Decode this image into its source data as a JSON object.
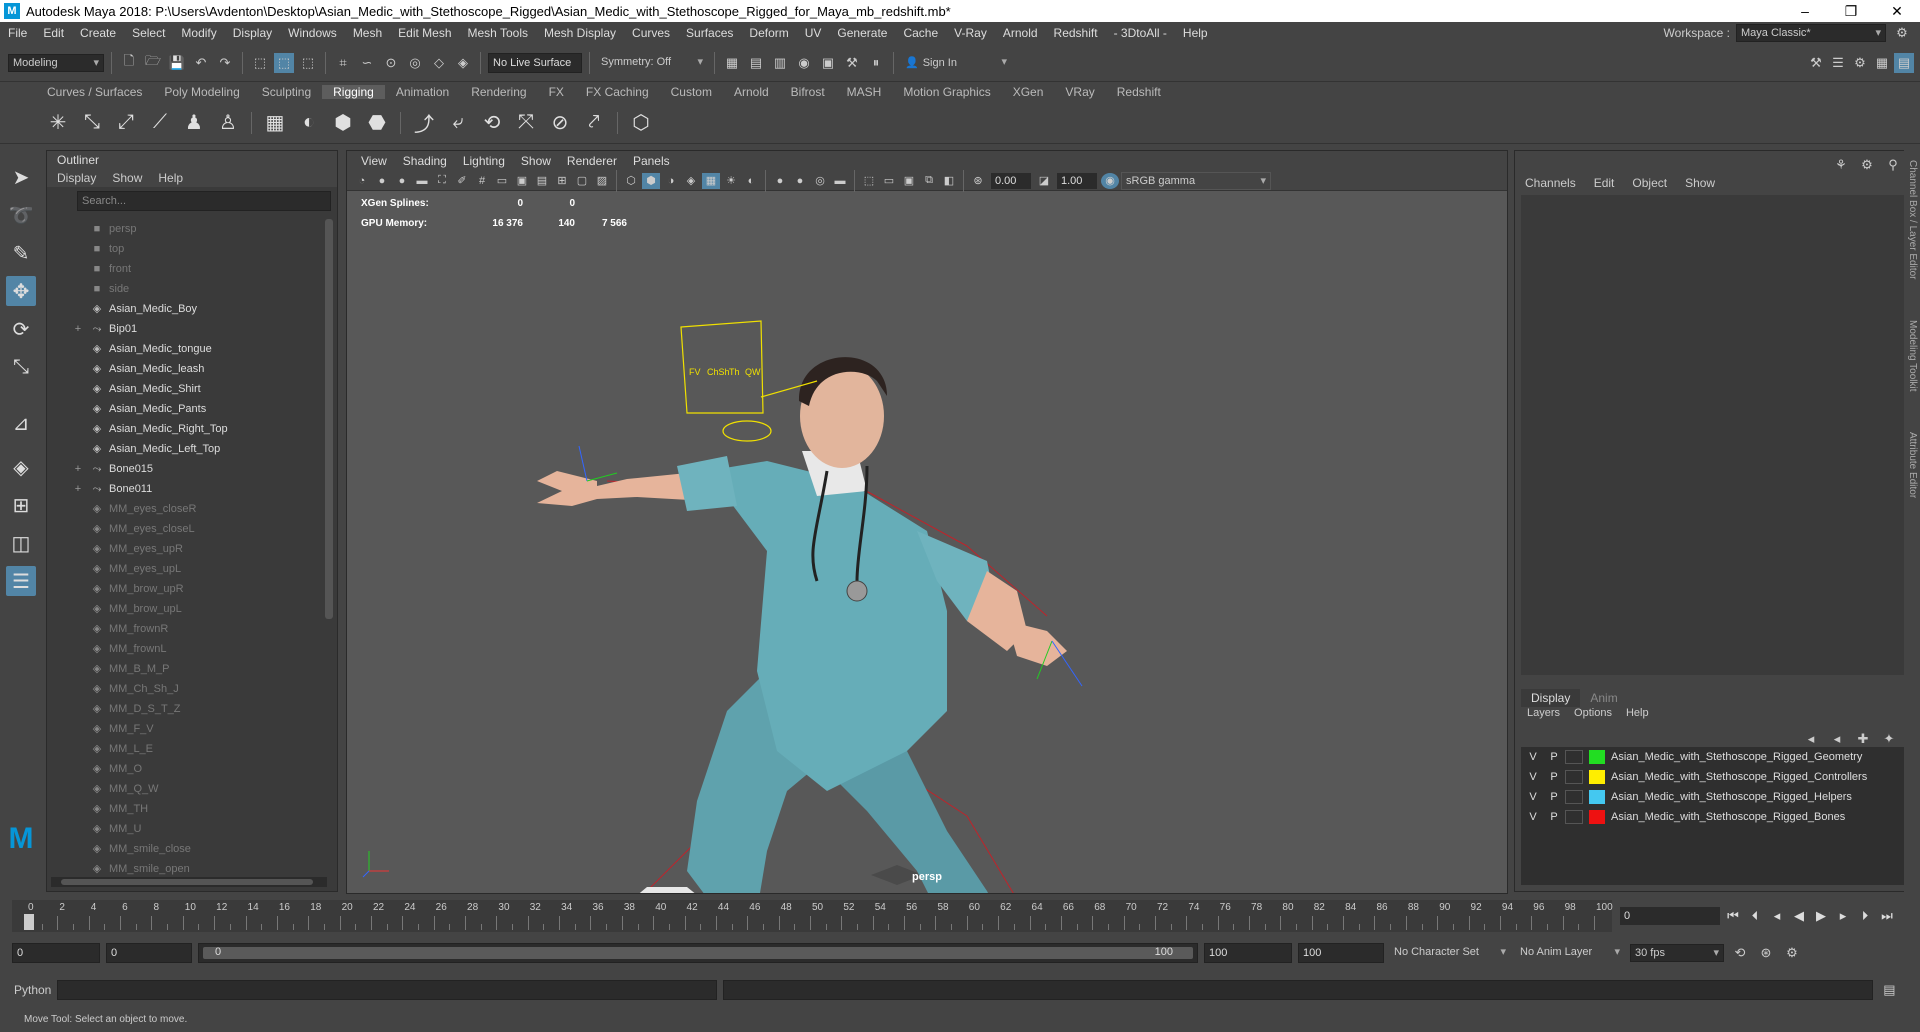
{
  "window": {
    "title": "Autodesk Maya 2018: P:\\Users\\Avdenton\\Desktop\\Asian_Medic_with_Stethoscope_Rigged\\Asian_Medic_with_Stethoscope_Rigged_for_Maya_mb_redshift.mb*",
    "logo": "M"
  },
  "menubar": {
    "items": [
      "File",
      "Edit",
      "Create",
      "Select",
      "Modify",
      "Display",
      "Windows",
      "Mesh",
      "Edit Mesh",
      "Mesh Tools",
      "Mesh Display",
      "Curves",
      "Surfaces",
      "Deform",
      "UV",
      "Generate",
      "Cache",
      "V-Ray",
      "Arnold",
      "Redshift",
      "- 3DtoAll -",
      "Help"
    ],
    "workspace_label": "Workspace :",
    "workspace_value": "Maya Classic*"
  },
  "statusline": {
    "mode": "Modeling",
    "live_surface": "No Live Surface",
    "symmetry": "Symmetry: Off",
    "sign_in": "Sign In"
  },
  "shelf": {
    "tabs": [
      "Curves / Surfaces",
      "Poly Modeling",
      "Sculpting",
      "Rigging",
      "Animation",
      "Rendering",
      "FX",
      "FX Caching",
      "Custom",
      "Arnold",
      "Bifrost",
      "MASH",
      "Motion Graphics",
      "XGen",
      "VRay",
      "Redshift"
    ],
    "active_tab": "Rigging"
  },
  "outliner": {
    "title": "Outliner",
    "menu": [
      "Display",
      "Show",
      "Help"
    ],
    "search_placeholder": "Search...",
    "items": [
      {
        "label": "persp",
        "dim": true,
        "expand": "",
        "icon": "camera-icon"
      },
      {
        "label": "top",
        "dim": true,
        "expand": "",
        "icon": "camera-icon"
      },
      {
        "label": "front",
        "dim": true,
        "expand": "",
        "icon": "camera-icon"
      },
      {
        "label": "side",
        "dim": true,
        "expand": "",
        "icon": "camera-icon"
      },
      {
        "label": "Asian_Medic_Boy",
        "dim": false,
        "expand": "",
        "icon": "mesh-icon"
      },
      {
        "label": "Bip01",
        "dim": false,
        "expand": "+",
        "icon": "joint-icon"
      },
      {
        "label": "Asian_Medic_tongue",
        "dim": false,
        "expand": "",
        "icon": "mesh-icon"
      },
      {
        "label": "Asian_Medic_leash",
        "dim": false,
        "expand": "",
        "icon": "mesh-icon"
      },
      {
        "label": "Asian_Medic_Shirt",
        "dim": false,
        "expand": "",
        "icon": "mesh-icon"
      },
      {
        "label": "Asian_Medic_Pants",
        "dim": false,
        "expand": "",
        "icon": "mesh-icon"
      },
      {
        "label": "Asian_Medic_Right_Top",
        "dim": false,
        "expand": "",
        "icon": "mesh-icon"
      },
      {
        "label": "Asian_Medic_Left_Top",
        "dim": false,
        "expand": "",
        "icon": "mesh-icon"
      },
      {
        "label": "Bone015",
        "dim": false,
        "expand": "+",
        "icon": "joint-icon"
      },
      {
        "label": "Bone011",
        "dim": false,
        "expand": "+",
        "icon": "joint-icon"
      },
      {
        "label": "MM_eyes_closeR",
        "dim": true,
        "expand": "",
        "icon": "mesh-icon"
      },
      {
        "label": "MM_eyes_closeL",
        "dim": true,
        "expand": "",
        "icon": "mesh-icon"
      },
      {
        "label": "MM_eyes_upR",
        "dim": true,
        "expand": "",
        "icon": "mesh-icon"
      },
      {
        "label": "MM_eyes_upL",
        "dim": true,
        "expand": "",
        "icon": "mesh-icon"
      },
      {
        "label": "MM_brow_upR",
        "dim": true,
        "expand": "",
        "icon": "mesh-icon"
      },
      {
        "label": "MM_brow_upL",
        "dim": true,
        "expand": "",
        "icon": "mesh-icon"
      },
      {
        "label": "MM_frownR",
        "dim": true,
        "expand": "",
        "icon": "mesh-icon"
      },
      {
        "label": "MM_frownL",
        "dim": true,
        "expand": "",
        "icon": "mesh-icon"
      },
      {
        "label": "MM_B_M_P",
        "dim": true,
        "expand": "",
        "icon": "mesh-icon"
      },
      {
        "label": "MM_Ch_Sh_J",
        "dim": true,
        "expand": "",
        "icon": "mesh-icon"
      },
      {
        "label": "MM_D_S_T_Z",
        "dim": true,
        "expand": "",
        "icon": "mesh-icon"
      },
      {
        "label": "MM_F_V",
        "dim": true,
        "expand": "",
        "icon": "mesh-icon"
      },
      {
        "label": "MM_L_E",
        "dim": true,
        "expand": "",
        "icon": "mesh-icon"
      },
      {
        "label": "MM_O",
        "dim": true,
        "expand": "",
        "icon": "mesh-icon"
      },
      {
        "label": "MM_Q_W",
        "dim": true,
        "expand": "",
        "icon": "mesh-icon"
      },
      {
        "label": "MM_TH",
        "dim": true,
        "expand": "",
        "icon": "mesh-icon"
      },
      {
        "label": "MM_U",
        "dim": true,
        "expand": "",
        "icon": "mesh-icon"
      },
      {
        "label": "MM_smile_close",
        "dim": true,
        "expand": "",
        "icon": "mesh-icon"
      },
      {
        "label": "MM_smile_open",
        "dim": true,
        "expand": "",
        "icon": "mesh-icon"
      }
    ]
  },
  "viewport": {
    "menu": [
      "View",
      "Shading",
      "Lighting",
      "Show",
      "Renderer",
      "Panels"
    ],
    "near_value": "0.00",
    "far_value": "1.00",
    "color_space": "sRGB gamma",
    "hud": [
      {
        "label": "XGen Splines:",
        "v1": "0",
        "v2": "0",
        "v3": ""
      },
      {
        "label": "GPU Memory:",
        "v1": "16 376",
        "v2": "140",
        "v3": "7 566"
      }
    ],
    "camera": "persp",
    "controller_labels": [
      "FV",
      "ChSh",
      "Th",
      "QW"
    ]
  },
  "channelbox": {
    "menu": [
      "Channels",
      "Edit",
      "Object",
      "Show"
    ],
    "layer_tabs": [
      "Display",
      "Anim"
    ],
    "layer_menu": [
      "Layers",
      "Options",
      "Help"
    ],
    "layers": [
      {
        "v": "V",
        "p": "P",
        "name": "Asian_Medic_with_Stethoscope_Rigged_Geometry",
        "color": "#22dd22"
      },
      {
        "v": "V",
        "p": "P",
        "name": "Asian_Medic_with_Stethoscope_Rigged_Controllers",
        "color": "#ffee00"
      },
      {
        "v": "V",
        "p": "P",
        "name": "Asian_Medic_with_Stethoscope_Rigged_Helpers",
        "color": "#44c8f0"
      },
      {
        "v": "V",
        "p": "P",
        "name": "Asian_Medic_with_Stethoscope_Rigged_Bones",
        "color": "#ee1111"
      }
    ],
    "side_tabs": [
      "Channel Box / Layer Editor",
      "Modeling Toolkit",
      "Attribute Editor"
    ]
  },
  "timeline": {
    "labels": [
      "0",
      "2",
      "4",
      "6",
      "8",
      "10",
      "12",
      "14",
      "16",
      "18",
      "20",
      "22",
      "24",
      "26",
      "28",
      "30",
      "32",
      "34",
      "36",
      "38",
      "40",
      "42",
      "44",
      "46",
      "48",
      "50",
      "52",
      "54",
      "56",
      "58",
      "60",
      "62",
      "64",
      "66",
      "68",
      "70",
      "72",
      "74",
      "76",
      "78",
      "80",
      "82",
      "84",
      "86",
      "88",
      "90",
      "92",
      "94",
      "96",
      "98",
      "100"
    ],
    "current_frame": "0"
  },
  "range": {
    "start": "0",
    "anim_start": "0",
    "slider_left": "0",
    "slider_right": "100",
    "anim_end": "100",
    "end": "100",
    "character_set": "No Character Set",
    "anim_layer": "No Anim Layer",
    "fps": "30 fps"
  },
  "cmdline": {
    "label": "Python"
  },
  "helpline": {
    "text": "Move Tool: Select an object to move."
  }
}
